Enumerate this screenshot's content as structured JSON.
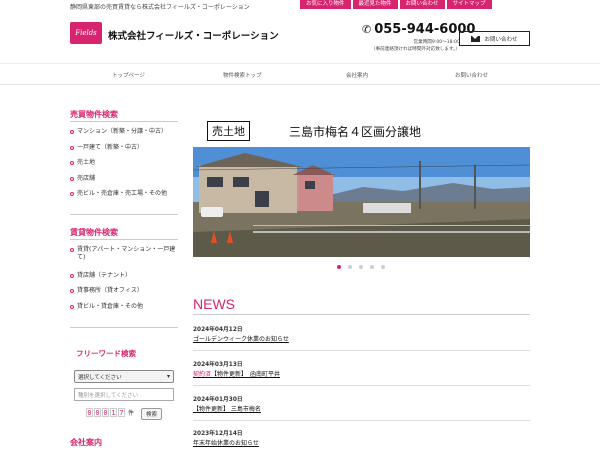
{
  "header": {
    "tagline": "静岡県東部の売買賃貸なら株式会社フィールズ・コーポレーション",
    "top_links": [
      "お気に入り物件",
      "最近見た物件",
      "お問い合わせ",
      "サイトマップ"
    ],
    "logo_text": "Fields",
    "company_name": "株式会社フィールズ・コーポレーション",
    "phone": "055-944-6000",
    "hours_line1": "営業時間9:00～18:00",
    "hours_line2": "（事前連絡頂ければ時間外対応致します。）",
    "contact_button": "お問い合わせ",
    "accent_color": "#d6246e"
  },
  "nav": [
    "トップページ",
    "物件検索トップ",
    "会社案内",
    "お問い合わせ"
  ],
  "sidebar": {
    "sale_heading": "売買物件検索",
    "sale_items": [
      "マンション（新築・分譲・中古）",
      "一戸建て（新築・中古）",
      "売土地",
      "売店舗",
      "売ビル・売倉庫・売工場・その他"
    ],
    "rent_heading": "賃貸物件検索",
    "rent_items": [
      "賃貸(アパート・マンション・一戸建て)",
      "貸店舗（テナント）",
      "貸事務所（貸オフィス）",
      "貸ビル・貸倉庫・その他"
    ],
    "freeword_heading": "フリーワード検索",
    "select_value": "選択してください",
    "keyword_placeholder": "種別を選択してください",
    "counter_digits": [
      "0",
      "0",
      "0",
      "1",
      "7"
    ],
    "counter_unit": "件",
    "search_button": "検索",
    "company_heading": "会社案内"
  },
  "hero": {
    "badge": "売土地",
    "title": "三島市梅名４区画分譲地",
    "slide_count": 5,
    "active_slide": 1
  },
  "news": {
    "heading": "NEWS",
    "items": [
      {
        "date": "2024年04月12日",
        "tag": "",
        "title": "ゴールデンウィーク休業のお知らせ"
      },
      {
        "date": "2024年03月13日",
        "tag": "契約済",
        "title": "【物件更新】　函南町平井"
      },
      {
        "date": "2024年01月30日",
        "tag": "",
        "title": "【物件更新】 三島市梅名"
      },
      {
        "date": "2023年12月14日",
        "tag": "",
        "title": "年末年始休業のお知らせ"
      }
    ]
  }
}
